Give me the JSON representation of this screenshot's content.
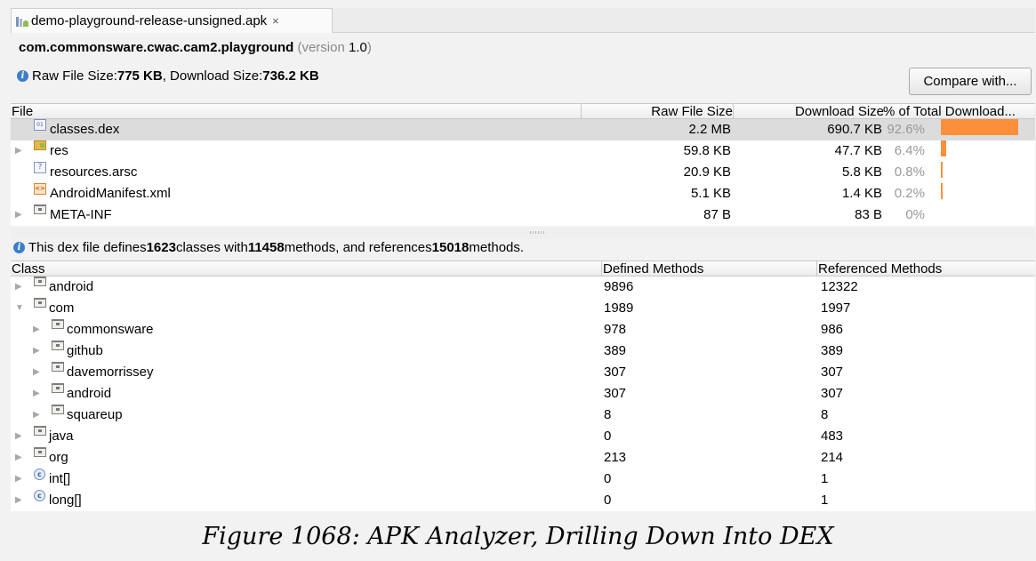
{
  "tab": {
    "title": "demo-playground-release-unsigned.apk",
    "close": "×"
  },
  "header": {
    "package": "com.commonsware.cwac.cam2.playground",
    "version_open": "(version ",
    "version": "1.0",
    "version_close": ")",
    "raw_label": "Raw File Size: ",
    "raw_value": "775 KB",
    "sep": ", Download Size: ",
    "download_value": "736.2 KB",
    "compare_button": "Compare with..."
  },
  "files_table": {
    "headers": [
      "File",
      "Raw File Size",
      "Download Size",
      "% of Total Download..."
    ],
    "rows": [
      {
        "name": "classes.dex",
        "icon": "dex-file-icon",
        "expandable": false,
        "raw": "2.2 MB",
        "download": "690.7 KB",
        "percent": "92.6%",
        "fraction": 0.926,
        "selected": true
      },
      {
        "name": "res",
        "icon": "resource-folder-icon",
        "expandable": true,
        "raw": "59.8 KB",
        "download": "47.7 KB",
        "percent": "6.4%",
        "fraction": 0.064
      },
      {
        "name": "resources.arsc",
        "icon": "arsc-file-icon",
        "expandable": false,
        "raw": "20.9 KB",
        "download": "5.8 KB",
        "percent": "0.8%",
        "fraction": 0.008
      },
      {
        "name": "AndroidManifest.xml",
        "icon": "xml-file-icon",
        "expandable": false,
        "raw": "5.1 KB",
        "download": "1.4 KB",
        "percent": "0.2%",
        "fraction": 0.002
      },
      {
        "name": "META-INF",
        "icon": "folder-icon",
        "expandable": true,
        "raw": "87 B",
        "download": "83 B",
        "percent": "0%",
        "fraction": 0
      }
    ]
  },
  "dex_info": {
    "t1": "This dex file defines ",
    "classes": "1623",
    "t2": " classes with ",
    "methods": "11458",
    "t3": " methods, and references ",
    "referenced": "15018",
    "t4": " methods."
  },
  "classes_table": {
    "headers": [
      "Class",
      "Defined Methods",
      "Referenced Methods"
    ],
    "rows": [
      {
        "name": "android",
        "kind": "package",
        "indent": 0,
        "arrow": "▶",
        "defined": "9896",
        "referenced": "12322"
      },
      {
        "name": "com",
        "kind": "package",
        "indent": 0,
        "arrow": "▼",
        "defined": "1989",
        "referenced": "1997"
      },
      {
        "name": "commonsware",
        "kind": "package",
        "indent": 1,
        "arrow": "▶",
        "defined": "978",
        "referenced": "986"
      },
      {
        "name": "github",
        "kind": "package",
        "indent": 1,
        "arrow": "▶",
        "defined": "389",
        "referenced": "389"
      },
      {
        "name": "davemorrissey",
        "kind": "package",
        "indent": 1,
        "arrow": "▶",
        "defined": "307",
        "referenced": "307"
      },
      {
        "name": "android",
        "kind": "package",
        "indent": 1,
        "arrow": "▶",
        "defined": "307",
        "referenced": "307"
      },
      {
        "name": "squareup",
        "kind": "package",
        "indent": 1,
        "arrow": "▶",
        "defined": "8",
        "referenced": "8"
      },
      {
        "name": "java",
        "kind": "package",
        "indent": 0,
        "arrow": "▶",
        "defined": "0",
        "referenced": "483"
      },
      {
        "name": "org",
        "kind": "package",
        "indent": 0,
        "arrow": "▶",
        "defined": "213",
        "referenced": "214"
      },
      {
        "name": "int[]",
        "kind": "class",
        "indent": 0,
        "arrow": "▶",
        "defined": "0",
        "referenced": "1"
      },
      {
        "name": "long[]",
        "kind": "class",
        "indent": 0,
        "arrow": "▶",
        "defined": "0",
        "referenced": "1"
      }
    ]
  },
  "caption": "Figure 1068: APK Analyzer, Drilling Down Into DEX",
  "colors": {
    "bar": "#fc8f3a",
    "selected_row": "#dcdcdc",
    "info_icon": "#3d7ec9"
  }
}
